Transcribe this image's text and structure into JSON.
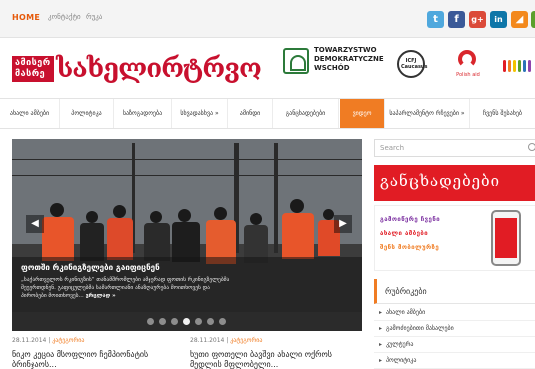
{
  "topbar": {
    "home": "HOME",
    "links": [
      "კონტაქტი",
      "რუკა"
    ],
    "social": [
      {
        "name": "twitter-icon",
        "glyph": "t"
      },
      {
        "name": "facebook-icon",
        "glyph": "f"
      },
      {
        "name": "googleplus-icon",
        "glyph": "g+"
      },
      {
        "name": "linkedin-icon",
        "glyph": "in"
      },
      {
        "name": "rss-icon",
        "glyph": "◢"
      }
    ]
  },
  "header": {
    "logo_small_line1": "ამისერ",
    "logo_small_line2": "მასრე",
    "logo_big": "სახელირტრვო",
    "partner1_text": "TOWARZYSTWO DEMOKRATYCZNE WSCHÓD",
    "partner2_text": "ICFJ Caucasus",
    "partner3_text": "Polish aid",
    "colors": {
      "accent": "#f07c23",
      "brand": "#c8102e"
    }
  },
  "nav": {
    "items": [
      {
        "label": "ახალი ამბები",
        "active": false
      },
      {
        "label": "პოლიტიკა",
        "active": false
      },
      {
        "label": "საზოგადოება",
        "active": false
      },
      {
        "label": "სხვადასხვა »",
        "active": false
      },
      {
        "label": "ამინდი",
        "active": false
      },
      {
        "label": "განცხადებები",
        "active": false
      },
      {
        "label": "ვიდეო",
        "active": true
      },
      {
        "label": "საპარლამენტო რჩევები »",
        "active": false
      },
      {
        "label": "ჩვენს შესახებ",
        "active": false
      }
    ]
  },
  "slider": {
    "title": "ფოთში რკინიგზელები გაიფიცნენ",
    "text_line1": "„საქართველოს რკინიგზის“ თანამშრომლები ამჯერად ფოთის რკინიგზელებმა",
    "text_line2": "შეუერთდნენ. გაფიცულებმა სამართლიანი ანაზღაურება მოითხოვეს და",
    "text_line3": "პირობები მოითხოვეს...",
    "more": "ვრცლად »",
    "slides_count": 7,
    "active_slide": 4
  },
  "articles": [
    {
      "date": "28.11.2014",
      "category": "კატეგორია",
      "title": "ნიკო კეცია მსოფლიო ჩემპიონატის ბრინჯაოს..."
    },
    {
      "date": "28.11.2014",
      "category": "კატეგორია",
      "title": "ხუთი ფოთელი ბავშვი ახალი ოქროს მედლის მფლობელი..."
    }
  ],
  "sidebar": {
    "search_placeholder": "Search",
    "banner1_text": "განცხადებები",
    "banner2_lines": [
      "გამოიწერე ჩვენი",
      "ახალი ამბები",
      "შენს მობილურზე"
    ],
    "rubric_title": "რუბრიკები",
    "rubrics": [
      "ახალი ამბები",
      "გამოძიებითი მასალები",
      "კულტურა",
      "პოლიტიკა"
    ]
  }
}
